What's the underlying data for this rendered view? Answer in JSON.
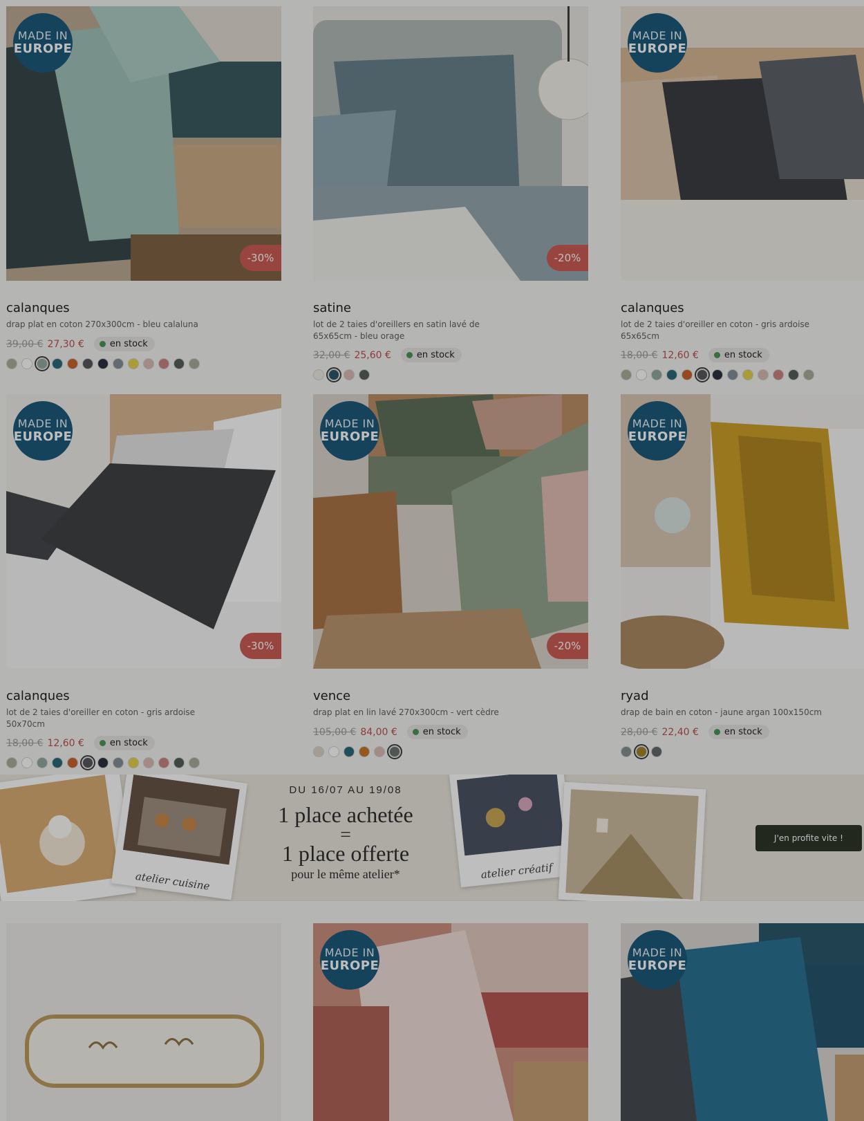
{
  "badge": {
    "line1": "MADE IN",
    "line2": "EUROPE"
  },
  "products": [
    {
      "brand": "calanques",
      "desc": "drap plat en coton 270x300cm - bleu calaluna",
      "old_price": "39,00 €",
      "new_price": "27,30 €",
      "stock": "en stock",
      "discount": "-30%"
    },
    {
      "brand": "satine",
      "desc": "lot de 2 taies d'oreillers en satin lavé de 65x65cm - bleu orage",
      "old_price": "32,00 €",
      "new_price": "25,60 €",
      "stock": "en stock",
      "discount": "-20%"
    },
    {
      "brand": "calanques",
      "desc": "lot de 2 taies d'oreiller en coton - gris ardoise 65x65cm",
      "old_price": "18,00 €",
      "new_price": "12,60 €",
      "stock": "en stock"
    },
    {
      "brand": "calanques",
      "desc": "lot de 2 taies d'oreiller en coton - gris ardoise 50x70cm",
      "old_price": "18,00 €",
      "new_price": "12,60 €",
      "stock": "en stock",
      "discount": "-30%"
    },
    {
      "brand": "vence",
      "desc": "drap plat en lin lavé 270x300cm - vert cèdre",
      "old_price": "105,00 €",
      "new_price": "84,00 €",
      "stock": "en stock",
      "discount": "-20%"
    },
    {
      "brand": "ryad",
      "desc": "drap de bain en coton - jaune argan 100x150cm",
      "old_price": "28,00 €",
      "new_price": "22,40 €",
      "stock": "en stock"
    }
  ],
  "swatch_sets": {
    "calanques": [
      "#a8a892",
      "#ffffff",
      "#8ca39a",
      "#1f5f73",
      "#c45a1e",
      "#4a4d52",
      "#1e2433",
      "#7b8891",
      "#e6cf3e",
      "#d6b7ad",
      "#c87a78",
      "#4b5550",
      "#a3a694"
    ],
    "satine": [
      "#eeeae0",
      "#1f4d60",
      "#d7b7ad",
      "#4b5552"
    ],
    "vence": [
      "#d9d0c6",
      "#ffffff",
      "#1f5f73",
      "#c46d1e",
      "#d7b7ad",
      "#626b67"
    ],
    "ryad": [
      "#7b8a8a",
      "#a17b1d",
      "#5b5f62"
    ]
  },
  "banner": {
    "dates": "DU 16/07 AU 19/08",
    "line1": "1 place achetée",
    "line2": "=",
    "line3": "1 place offerte",
    "line4": "pour le même atelier*",
    "caption_left": "atelier cuisine",
    "caption_right": "atelier créatif",
    "cta": "J'en profite vite !"
  }
}
